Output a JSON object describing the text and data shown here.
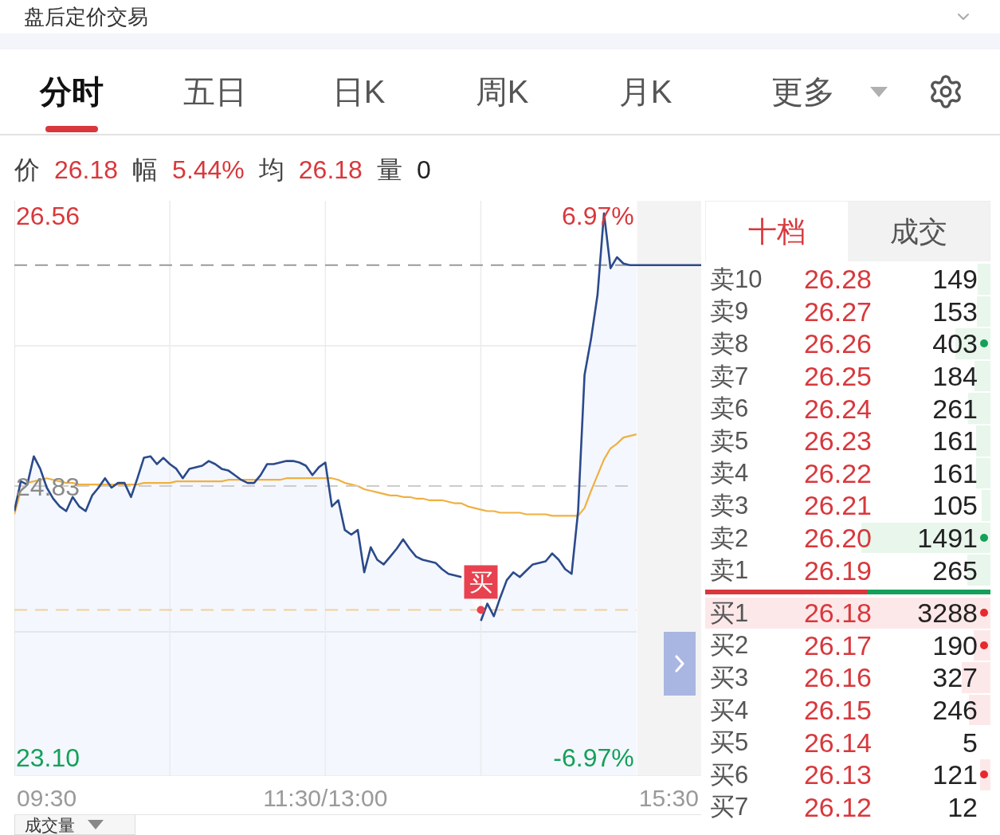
{
  "header": {
    "title": "盘后定价交易"
  },
  "period_tabs": [
    {
      "label": "分时",
      "selected": true,
      "kind": "view"
    },
    {
      "label": "五日",
      "selected": false,
      "kind": "view"
    },
    {
      "label": "日K",
      "selected": false,
      "kind": "view"
    },
    {
      "label": "周K",
      "selected": false,
      "kind": "view"
    },
    {
      "label": "月K",
      "selected": false,
      "kind": "view"
    },
    {
      "label": "更多",
      "selected": false,
      "kind": "menu"
    }
  ],
  "quote": [
    {
      "label": "价",
      "value": "26.18",
      "color": "#d8383c"
    },
    {
      "label": "幅",
      "value": "5.44%",
      "color": "#d8383c"
    },
    {
      "label": "均",
      "value": "26.18",
      "color": "#d8383c"
    },
    {
      "label": "量",
      "value": "0",
      "color": "#222222"
    }
  ],
  "chart": {
    "percent_labels": [
      "6.97%",
      "-6.97%"
    ],
    "chart_data": {
      "type": "line",
      "categories": [
        null,
        null,
        null,
        null,
        null,
        "09:30",
        null,
        null,
        null,
        null,
        null,
        null,
        null,
        null,
        null,
        null,
        null,
        null,
        null,
        null,
        null,
        null,
        null,
        null,
        null,
        null,
        null,
        null,
        null,
        null,
        null,
        null,
        null,
        null,
        null,
        null,
        null,
        null,
        null,
        null,
        null,
        null,
        null,
        null,
        null,
        null,
        null,
        null,
        "11:30/13:00",
        null,
        null,
        null,
        null,
        null,
        null,
        null,
        null,
        null,
        null,
        null,
        null,
        null,
        null,
        null,
        null,
        null,
        null,
        null,
        null,
        null,
        null,
        null,
        null,
        null,
        null,
        null,
        null,
        null,
        null,
        null,
        null,
        null,
        null,
        null,
        null,
        null,
        null,
        null,
        null,
        null,
        null,
        null,
        null,
        null,
        null,
        null,
        null,
        null,
        null,
        null,
        null,
        "15:30",
        null,
        null,
        null,
        null,
        null
      ],
      "series": [
        {
          "color": "#2b4a8b",
          "values": [
            24.67,
            24.86,
            24.84,
            25.02,
            24.94,
            24.82,
            24.75,
            24.7,
            24.67,
            24.76,
            24.7,
            24.67,
            24.77,
            24.82,
            24.88,
            24.82,
            24.85,
            24.85,
            24.76,
            24.88,
            25.01,
            25.02,
            24.97,
            25.01,
            24.97,
            24.94,
            24.88,
            24.94,
            24.95,
            24.96,
            24.99,
            24.97,
            24.94,
            24.93,
            24.9,
            24.87,
            24.85,
            24.85,
            24.9,
            24.97,
            24.97,
            24.98,
            24.99,
            24.99,
            24.98,
            24.96,
            24.9,
            24.95,
            24.98,
            24.7,
            24.74,
            24.55,
            24.52,
            24.55,
            24.28,
            24.44,
            24.36,
            24.33,
            24.38,
            24.43,
            24.49,
            24.43,
            24.38,
            24.36,
            24.35,
            24.34,
            24.3,
            24.27,
            24.26,
            24.25,
            null,
            null,
            23.97,
            24.08,
            24.0,
            24.12,
            24.23,
            24.28,
            24.25,
            24.29,
            24.33,
            24.34,
            24.35,
            24.4,
            24.36,
            24.3,
            24.27,
            24.67,
            25.54,
            25.77,
            26.05,
            26.57,
            26.22,
            26.29,
            26.25,
            26.24,
            26.24,
            26.24,
            26.24,
            26.24,
            26.24,
            26.24,
            26.24,
            26.24,
            26.24,
            26.24,
            26.24
          ]
        },
        {
          "color": "#f0b040",
          "values": [
            24.65,
            24.8,
            24.85,
            24.86,
            24.87,
            24.88,
            24.87,
            24.86,
            24.85,
            24.85,
            24.84,
            24.84,
            24.84,
            24.84,
            24.84,
            24.84,
            24.84,
            24.84,
            24.84,
            24.84,
            24.85,
            24.85,
            24.85,
            24.85,
            24.85,
            24.86,
            24.86,
            24.86,
            24.86,
            24.86,
            24.86,
            24.86,
            24.86,
            24.87,
            24.87,
            24.87,
            24.87,
            24.87,
            24.87,
            24.87,
            24.87,
            24.87,
            24.88,
            24.88,
            24.88,
            24.88,
            24.88,
            24.88,
            24.88,
            24.88,
            24.87,
            24.85,
            24.84,
            24.83,
            24.81,
            24.8,
            24.79,
            24.78,
            24.77,
            24.77,
            24.76,
            24.76,
            24.75,
            24.75,
            24.74,
            24.74,
            24.74,
            24.73,
            24.72,
            24.72,
            24.7,
            24.69,
            24.68,
            24.67,
            24.67,
            24.66,
            24.66,
            24.66,
            24.66,
            24.65,
            24.65,
            24.65,
            24.65,
            24.64,
            24.64,
            24.64,
            24.64,
            24.64,
            24.69,
            24.8,
            24.9,
            25.0,
            25.07,
            25.1,
            25.14,
            25.15,
            25.16,
            null,
            null,
            null,
            null,
            null,
            null,
            null,
            null,
            null,
            null
          ]
        },
        {
          "color": "#9a9a9a",
          "line_style": "dashed",
          "values": [
            26.24,
            26.24,
            26.24,
            26.24,
            26.24,
            26.24,
            26.24,
            26.24,
            26.24,
            26.24,
            26.24,
            26.24,
            26.24,
            26.24,
            26.24,
            26.24,
            26.24,
            26.24,
            26.24,
            26.24,
            26.24,
            26.24,
            26.24,
            26.24,
            26.24,
            26.24,
            26.24,
            26.24,
            26.24,
            26.24,
            26.24,
            26.24,
            26.24,
            26.24,
            26.24,
            26.24,
            26.24,
            26.24,
            26.24,
            26.24,
            26.24,
            26.24,
            26.24,
            26.24,
            26.24,
            26.24,
            26.24,
            26.24,
            26.24,
            26.24,
            26.24,
            26.24,
            26.24,
            26.24,
            26.24,
            26.24,
            26.24,
            26.24,
            26.24,
            26.24,
            26.24,
            26.24,
            26.24,
            26.24,
            26.24,
            26.24,
            26.24,
            26.24,
            26.24,
            26.24,
            26.24,
            26.24,
            26.24,
            26.24,
            26.24,
            26.24,
            26.24,
            26.24,
            26.24,
            26.24,
            26.24,
            26.24,
            26.24,
            26.24,
            26.24,
            26.24,
            26.24,
            26.24,
            26.24,
            26.24,
            26.24,
            26.24,
            26.24,
            26.24,
            26.24,
            26.24,
            26.24,
            null,
            null,
            null,
            null,
            null,
            null,
            null,
            null,
            null,
            null
          ]
        },
        {
          "color": "#cccccc",
          "line_style": "dashed",
          "values": [
            24.83,
            24.83,
            24.83,
            24.83,
            24.83,
            24.83,
            24.83,
            24.83,
            24.83,
            24.83,
            24.83,
            24.83,
            24.83,
            24.83,
            24.83,
            24.83,
            24.83,
            24.83,
            24.83,
            24.83,
            24.83,
            24.83,
            24.83,
            24.83,
            24.83,
            24.83,
            24.83,
            24.83,
            24.83,
            24.83,
            24.83,
            24.83,
            24.83,
            24.83,
            24.83,
            24.83,
            24.83,
            24.83,
            24.83,
            24.83,
            24.83,
            24.83,
            24.83,
            24.83,
            24.83,
            24.83,
            24.83,
            24.83,
            24.83,
            24.83,
            24.83,
            24.83,
            24.83,
            24.83,
            24.83,
            24.83,
            24.83,
            24.83,
            24.83,
            24.83,
            24.83,
            24.83,
            24.83,
            24.83,
            24.83,
            24.83,
            24.83,
            24.83,
            24.83,
            24.83,
            24.83,
            24.83,
            24.83,
            24.83,
            24.83,
            24.83,
            24.83,
            24.83,
            24.83,
            24.83,
            24.83,
            24.83,
            24.83,
            24.83,
            24.83,
            24.83,
            24.83,
            24.83,
            24.83,
            24.83,
            24.83,
            24.83,
            24.83,
            24.83,
            24.83,
            24.83,
            null,
            null,
            null,
            null,
            null,
            null,
            null,
            null,
            null,
            null,
            null
          ]
        },
        {
          "color": "#f2cf9a",
          "line_style": "dashed",
          "values": [
            24.04,
            24.04,
            24.04,
            24.04,
            24.04,
            24.04,
            24.04,
            24.04,
            24.04,
            24.04,
            24.04,
            24.04,
            24.04,
            24.04,
            24.04,
            24.04,
            24.04,
            24.04,
            24.04,
            24.04,
            24.04,
            24.04,
            24.04,
            24.04,
            24.04,
            24.04,
            24.04,
            24.04,
            24.04,
            24.04,
            24.04,
            24.04,
            24.04,
            24.04,
            24.04,
            24.04,
            24.04,
            24.04,
            24.04,
            24.04,
            24.04,
            24.04,
            24.04,
            24.04,
            24.04,
            24.04,
            24.04,
            24.04,
            24.04,
            24.04,
            24.04,
            24.04,
            24.04,
            24.04,
            24.04,
            24.04,
            24.04,
            24.04,
            24.04,
            24.04,
            24.04,
            24.04,
            24.04,
            24.04,
            24.04,
            24.04,
            24.04,
            24.04,
            24.04,
            24.04,
            24.04,
            24.04,
            24.04,
            24.04,
            24.04,
            24.04,
            24.04,
            24.04,
            24.04,
            24.04,
            24.04,
            24.04,
            24.04,
            24.04,
            24.04,
            24.04,
            24.04,
            24.04,
            24.04,
            24.04,
            24.04,
            24.04,
            24.04,
            24.04,
            24.04,
            24.04,
            24.04,
            null,
            null,
            null,
            null,
            null,
            null,
            null,
            null,
            null,
            null
          ]
        }
      ],
      "ylim": [
        22.98,
        26.65
      ],
      "yticks": [
        {
          "value": 26.56,
          "label": "26.56"
        },
        {
          "value": 24.83,
          "label": "24.83"
        },
        {
          "value": 23.1,
          "label": "23.10"
        }
      ],
      "annotations": [
        "买"
      ]
    }
  },
  "order_book": {
    "tabs": [
      {
        "label": "十档",
        "selected": true
      },
      {
        "label": "成交",
        "selected": false
      }
    ],
    "asks": [
      {
        "label": "卖10",
        "price": "26.28",
        "volume": "149",
        "dot": false
      },
      {
        "label": "卖9",
        "price": "26.27",
        "volume": "153",
        "dot": false
      },
      {
        "label": "卖8",
        "price": "26.26",
        "volume": "403",
        "dot": true
      },
      {
        "label": "卖7",
        "price": "26.25",
        "volume": "184",
        "dot": false
      },
      {
        "label": "卖6",
        "price": "26.24",
        "volume": "261",
        "dot": false
      },
      {
        "label": "卖5",
        "price": "26.23",
        "volume": "161",
        "dot": false
      },
      {
        "label": "卖4",
        "price": "26.22",
        "volume": "161",
        "dot": false
      },
      {
        "label": "卖3",
        "price": "26.21",
        "volume": "105",
        "dot": false
      },
      {
        "label": "卖2",
        "price": "26.20",
        "volume": "1491",
        "dot": true
      },
      {
        "label": "卖1",
        "price": "26.19",
        "volume": "265",
        "dot": false
      }
    ],
    "split_bar": {
      "level": 0.57
    },
    "bids": [
      {
        "label": "买1",
        "price": "26.18",
        "volume": "3288",
        "dot": true
      },
      {
        "label": "买2",
        "price": "26.17",
        "volume": "190",
        "dot": true
      },
      {
        "label": "买3",
        "price": "26.16",
        "volume": "327",
        "dot": false
      },
      {
        "label": "买4",
        "price": "26.15",
        "volume": "246",
        "dot": false
      },
      {
        "label": "买5",
        "price": "26.14",
        "volume": "5",
        "dot": false
      },
      {
        "label": "买6",
        "price": "26.13",
        "volume": "121",
        "dot": true
      },
      {
        "label": "买7",
        "price": "26.12",
        "volume": "12",
        "dot": false
      }
    ]
  },
  "indicator_selector": {
    "label": "成交量"
  }
}
